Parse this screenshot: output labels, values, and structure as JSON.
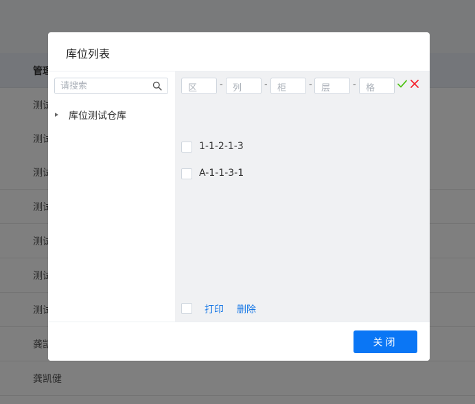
{
  "background": {
    "header_label": "管理",
    "rows": [
      "测试",
      "测试",
      "测试",
      "测试",
      "测试",
      "测试",
      "测试",
      "龚凯",
      "龚凯健"
    ]
  },
  "modal": {
    "title": "库位列表",
    "search": {
      "placeholder": "请搜索",
      "value": ""
    },
    "tree": [
      {
        "label": "库位测试仓库"
      }
    ],
    "coordinate_fields": [
      {
        "placeholder": "区"
      },
      {
        "placeholder": "列"
      },
      {
        "placeholder": "柜"
      },
      {
        "placeholder": "层"
      },
      {
        "placeholder": "格"
      }
    ],
    "coordinate_separator": "-",
    "locations": [
      {
        "label": "1-1-2-1-3",
        "checked": false
      },
      {
        "label": "A-1-1-3-1",
        "checked": false
      }
    ],
    "actions": {
      "print": "打印",
      "delete": "删除"
    },
    "close_label": "关闭"
  },
  "colors": {
    "accent": "#0a76f5",
    "link": "#1677e6",
    "confirm": "#52c41a",
    "cancel": "#f5222d"
  }
}
